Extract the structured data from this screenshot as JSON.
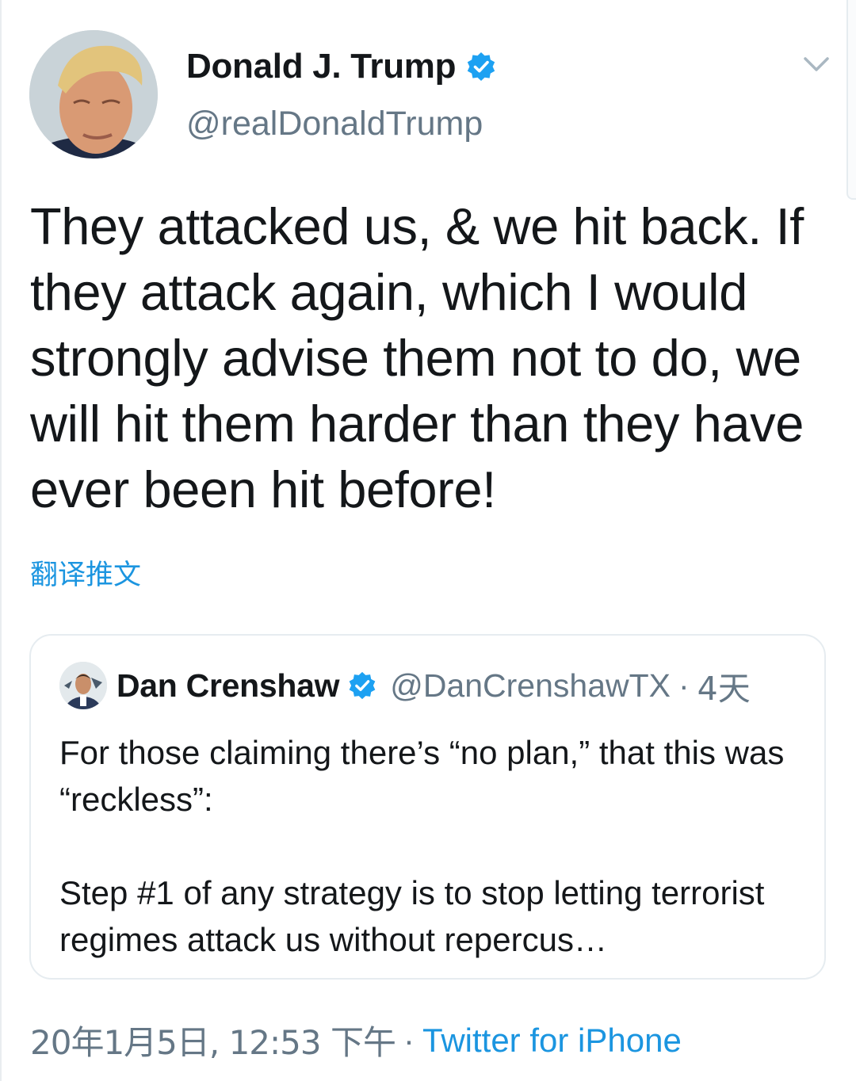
{
  "tweet": {
    "author_name": "Donald J. Trump",
    "handle": "@realDonaldTrump",
    "verified": true,
    "text": "They attacked us, & we hit back. If they attack again, which I would strongly advise them not to do, we will hit them harder than they have ever been hit before!",
    "translate_label": "翻译推文",
    "timestamp": "20年1月5日, 12:53 下午",
    "separator": "·",
    "source": "Twitter for iPhone"
  },
  "quoted_tweet": {
    "author_name": "Dan Crenshaw",
    "handle": "@DanCrenshawTX",
    "verified": true,
    "separator": "·",
    "age": "4天",
    "text_paragraph_1": "For those claiming there’s “no plan,” that this was “reckless”:",
    "text_paragraph_2": "Step #1 of any strategy is to stop letting terrorist regimes attack us without repercus…"
  },
  "icons": {
    "verified": "verified-badge-icon",
    "more_menu": "chevron-down-icon"
  },
  "colors": {
    "text_primary": "#14171a",
    "text_secondary": "#657786",
    "link_blue": "#1b95e0",
    "border": "#e6ecf0"
  }
}
